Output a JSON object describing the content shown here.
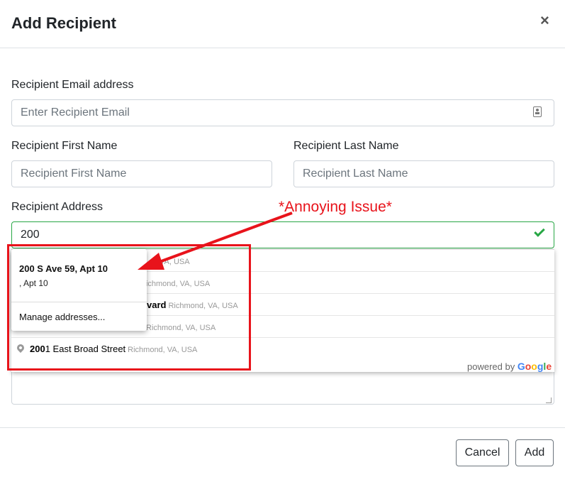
{
  "modal": {
    "title": "Add Recipient",
    "close_glyph": "×"
  },
  "form": {
    "email_label": "Recipient Email address",
    "email_placeholder": "Enter Recipient Email",
    "first_name_label": "Recipient First Name",
    "first_name_placeholder": "Recipient First Name",
    "last_name_label": "Recipient Last Name",
    "last_name_placeholder": "Recipient Last Name",
    "address_label": "Recipient Address",
    "address_value": "200"
  },
  "places_dropdown": {
    "items": [
      {
        "main": "",
        "secondary": "VA, USA"
      },
      {
        "main": "",
        "secondary": "Richmond, VA, USA"
      },
      {
        "main": "vard",
        "secondary": "Richmond, VA, USA"
      },
      {
        "main": "",
        "secondary": "Richmond, VA, USA"
      },
      {
        "match": "200",
        "main": "1 East Broad Street",
        "secondary": "Richmond, VA, USA"
      }
    ],
    "powered_by": "powered by",
    "google": "Google"
  },
  "autofill": {
    "line1": "200 S Ave 59, Apt 10",
    "line2": ", Apt 10",
    "manage": "Manage addresses..."
  },
  "footer": {
    "cancel_label": "Cancel",
    "add_label": "Add"
  },
  "annotation": {
    "text": "*Annoying Issue*",
    "color": "#e8131b"
  },
  "colors": {
    "valid": "#28a745",
    "border": "#ced4da"
  }
}
